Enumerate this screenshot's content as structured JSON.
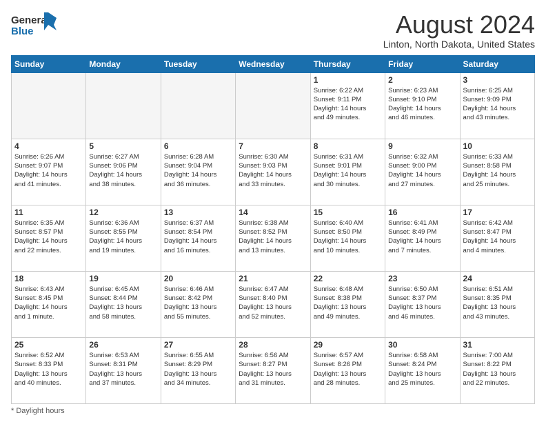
{
  "logo": {
    "line1": "General",
    "line2": "Blue"
  },
  "header": {
    "month": "August 2024",
    "location": "Linton, North Dakota, United States"
  },
  "days_of_week": [
    "Sunday",
    "Monday",
    "Tuesday",
    "Wednesday",
    "Thursday",
    "Friday",
    "Saturday"
  ],
  "footer": {
    "note": "Daylight hours"
  },
  "weeks": [
    [
      {
        "day": "",
        "info": ""
      },
      {
        "day": "",
        "info": ""
      },
      {
        "day": "",
        "info": ""
      },
      {
        "day": "",
        "info": ""
      },
      {
        "day": "1",
        "info": "Sunrise: 6:22 AM\nSunset: 9:11 PM\nDaylight: 14 hours\nand 49 minutes."
      },
      {
        "day": "2",
        "info": "Sunrise: 6:23 AM\nSunset: 9:10 PM\nDaylight: 14 hours\nand 46 minutes."
      },
      {
        "day": "3",
        "info": "Sunrise: 6:25 AM\nSunset: 9:09 PM\nDaylight: 14 hours\nand 43 minutes."
      }
    ],
    [
      {
        "day": "4",
        "info": "Sunrise: 6:26 AM\nSunset: 9:07 PM\nDaylight: 14 hours\nand 41 minutes."
      },
      {
        "day": "5",
        "info": "Sunrise: 6:27 AM\nSunset: 9:06 PM\nDaylight: 14 hours\nand 38 minutes."
      },
      {
        "day": "6",
        "info": "Sunrise: 6:28 AM\nSunset: 9:04 PM\nDaylight: 14 hours\nand 36 minutes."
      },
      {
        "day": "7",
        "info": "Sunrise: 6:30 AM\nSunset: 9:03 PM\nDaylight: 14 hours\nand 33 minutes."
      },
      {
        "day": "8",
        "info": "Sunrise: 6:31 AM\nSunset: 9:01 PM\nDaylight: 14 hours\nand 30 minutes."
      },
      {
        "day": "9",
        "info": "Sunrise: 6:32 AM\nSunset: 9:00 PM\nDaylight: 14 hours\nand 27 minutes."
      },
      {
        "day": "10",
        "info": "Sunrise: 6:33 AM\nSunset: 8:58 PM\nDaylight: 14 hours\nand 25 minutes."
      }
    ],
    [
      {
        "day": "11",
        "info": "Sunrise: 6:35 AM\nSunset: 8:57 PM\nDaylight: 14 hours\nand 22 minutes."
      },
      {
        "day": "12",
        "info": "Sunrise: 6:36 AM\nSunset: 8:55 PM\nDaylight: 14 hours\nand 19 minutes."
      },
      {
        "day": "13",
        "info": "Sunrise: 6:37 AM\nSunset: 8:54 PM\nDaylight: 14 hours\nand 16 minutes."
      },
      {
        "day": "14",
        "info": "Sunrise: 6:38 AM\nSunset: 8:52 PM\nDaylight: 14 hours\nand 13 minutes."
      },
      {
        "day": "15",
        "info": "Sunrise: 6:40 AM\nSunset: 8:50 PM\nDaylight: 14 hours\nand 10 minutes."
      },
      {
        "day": "16",
        "info": "Sunrise: 6:41 AM\nSunset: 8:49 PM\nDaylight: 14 hours\nand 7 minutes."
      },
      {
        "day": "17",
        "info": "Sunrise: 6:42 AM\nSunset: 8:47 PM\nDaylight: 14 hours\nand 4 minutes."
      }
    ],
    [
      {
        "day": "18",
        "info": "Sunrise: 6:43 AM\nSunset: 8:45 PM\nDaylight: 14 hours\nand 1 minute."
      },
      {
        "day": "19",
        "info": "Sunrise: 6:45 AM\nSunset: 8:44 PM\nDaylight: 13 hours\nand 58 minutes."
      },
      {
        "day": "20",
        "info": "Sunrise: 6:46 AM\nSunset: 8:42 PM\nDaylight: 13 hours\nand 55 minutes."
      },
      {
        "day": "21",
        "info": "Sunrise: 6:47 AM\nSunset: 8:40 PM\nDaylight: 13 hours\nand 52 minutes."
      },
      {
        "day": "22",
        "info": "Sunrise: 6:48 AM\nSunset: 8:38 PM\nDaylight: 13 hours\nand 49 minutes."
      },
      {
        "day": "23",
        "info": "Sunrise: 6:50 AM\nSunset: 8:37 PM\nDaylight: 13 hours\nand 46 minutes."
      },
      {
        "day": "24",
        "info": "Sunrise: 6:51 AM\nSunset: 8:35 PM\nDaylight: 13 hours\nand 43 minutes."
      }
    ],
    [
      {
        "day": "25",
        "info": "Sunrise: 6:52 AM\nSunset: 8:33 PM\nDaylight: 13 hours\nand 40 minutes."
      },
      {
        "day": "26",
        "info": "Sunrise: 6:53 AM\nSunset: 8:31 PM\nDaylight: 13 hours\nand 37 minutes."
      },
      {
        "day": "27",
        "info": "Sunrise: 6:55 AM\nSunset: 8:29 PM\nDaylight: 13 hours\nand 34 minutes."
      },
      {
        "day": "28",
        "info": "Sunrise: 6:56 AM\nSunset: 8:27 PM\nDaylight: 13 hours\nand 31 minutes."
      },
      {
        "day": "29",
        "info": "Sunrise: 6:57 AM\nSunset: 8:26 PM\nDaylight: 13 hours\nand 28 minutes."
      },
      {
        "day": "30",
        "info": "Sunrise: 6:58 AM\nSunset: 8:24 PM\nDaylight: 13 hours\nand 25 minutes."
      },
      {
        "day": "31",
        "info": "Sunrise: 7:00 AM\nSunset: 8:22 PM\nDaylight: 13 hours\nand 22 minutes."
      }
    ]
  ]
}
